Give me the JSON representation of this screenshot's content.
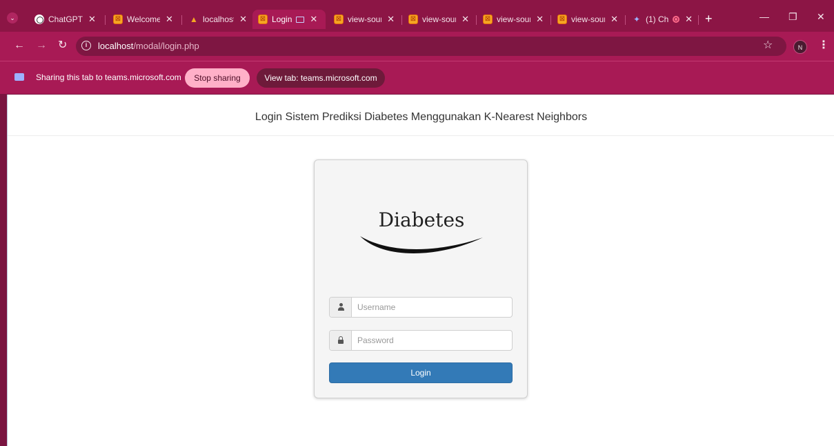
{
  "tabs": [
    {
      "label": "ChatGPT",
      "favicon": "chatgpt-icon",
      "active": false
    },
    {
      "label": "Welcome",
      "favicon": "xampp-icon",
      "active": false
    },
    {
      "label": "localhost",
      "favicon": "phpmyadmin-icon",
      "active": false
    },
    {
      "label": "Login",
      "favicon": "xampp-icon",
      "active": true
    },
    {
      "label": "view-sour",
      "favicon": "xampp-icon",
      "active": false
    },
    {
      "label": "view-sour",
      "favicon": "xampp-icon",
      "active": false
    },
    {
      "label": "view-sour",
      "favicon": "xampp-icon",
      "active": false
    },
    {
      "label": "view-sour",
      "favicon": "xampp-icon",
      "active": false
    },
    {
      "label": "(1) Ch",
      "favicon": "teams-icon",
      "active": false
    }
  ],
  "address_bar": {
    "host": "localhost",
    "path": "/modal/login.php",
    "profile_initial": "N"
  },
  "sharing_bar": {
    "message": "Sharing this tab to teams.microsoft.com",
    "stop_label": "Stop sharing",
    "view_label": "View tab: teams.microsoft.com"
  },
  "page": {
    "title": "Login Sistem Prediksi Diabetes Menggunakan K-Nearest Neighbors",
    "logo_text": "Diabetes",
    "username_placeholder": "Username",
    "password_placeholder": "Password",
    "login_label": "Login"
  },
  "colors": {
    "browser_frame": "#a81a55",
    "primary_button": "#337ab7",
    "stop_sharing_button": "#ffb0c8"
  }
}
